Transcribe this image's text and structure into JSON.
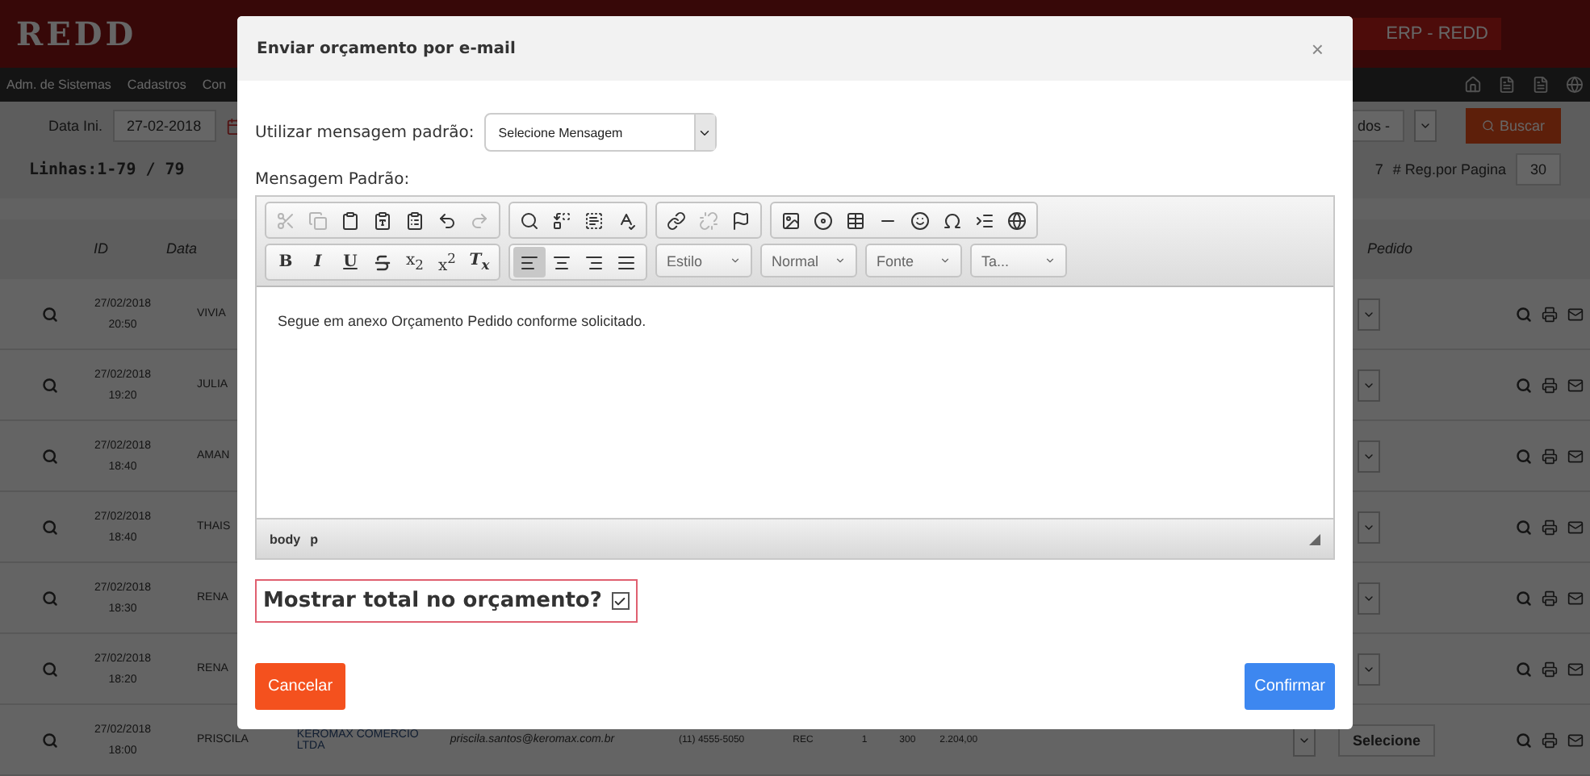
{
  "app": {
    "logo": "REDD",
    "system": "ERP - REDD",
    "nav": [
      "Adm. de Sistemas",
      "Cadastros",
      "Con"
    ],
    "filter": {
      "start_label": "Data Ini.",
      "start_value": "27-02-2018",
      "status_value": "dos -",
      "search_button": "Buscar"
    },
    "lines": "Linhas:1-79 / 79",
    "page_count": "7",
    "per_page_label": "# Reg.por Pagina",
    "per_page_value": "30",
    "columns": {
      "id": "ID",
      "date": "Data",
      "order": "Pedido"
    },
    "rows": [
      {
        "date": "27/02/2018",
        "time": "20:50",
        "name": "VIVIA"
      },
      {
        "date": "27/02/2018",
        "time": "19:20",
        "name": "JULIA"
      },
      {
        "date": "27/02/2018",
        "time": "18:40",
        "name": "AMAN"
      },
      {
        "date": "27/02/2018",
        "time": "18:40",
        "name": "THAIS"
      },
      {
        "date": "27/02/2018",
        "time": "18:30",
        "name": "RENA"
      },
      {
        "date": "27/02/2018",
        "time": "18:20",
        "name": "RENA"
      },
      {
        "date": "27/02/2018",
        "time": "18:00",
        "name": "PRISCILA",
        "details": {
          "company": "KEROMAX COMERCIO LTDA",
          "email": "priscila.santos@keromax.com.br",
          "phone": "(11) 4555-5050",
          "type": "REC",
          "qty": "1",
          "unit": "300",
          "total": "2.204,00",
          "status": "Selecione"
        }
      }
    ]
  },
  "dialog": {
    "title": "Enviar orçamento por e-mail",
    "close": "×",
    "template_label": "Utilizar mensagem padrão:",
    "template_value": "Selecione Mensagem",
    "message_label": "Mensagem Padrão:",
    "toolbar": [
      [
        {
          "kind": "cut",
          "disabled": true
        },
        {
          "kind": "copy",
          "disabled": true
        },
        {
          "kind": "paste",
          "disabled": false
        },
        {
          "kind": "paste-text",
          "disabled": false
        },
        {
          "kind": "paste-word",
          "disabled": false
        },
        {
          "kind": "undo",
          "disabled": false
        },
        {
          "kind": "redo",
          "disabled": true
        }
      ],
      [
        {
          "kind": "find",
          "disabled": false
        },
        {
          "kind": "replace",
          "disabled": false
        },
        {
          "kind": "select-all",
          "disabled": false
        },
        {
          "kind": "spell",
          "disabled": false
        }
      ],
      [
        {
          "kind": "link",
          "disabled": false
        },
        {
          "kind": "unlink",
          "disabled": true
        },
        {
          "kind": "anchor",
          "disabled": false
        }
      ],
      [
        {
          "kind": "image",
          "disabled": false
        },
        {
          "kind": "flash",
          "disabled": false
        },
        {
          "kind": "table",
          "disabled": false
        },
        {
          "kind": "rule",
          "disabled": false
        },
        {
          "kind": "smiley",
          "disabled": false
        },
        {
          "kind": "omega",
          "disabled": false
        },
        {
          "kind": "pagebreak",
          "disabled": false
        },
        {
          "kind": "iframe",
          "disabled": false
        }
      ]
    ],
    "format_buttons": [
      {
        "label": "B",
        "kind": "bold"
      },
      {
        "label": "I",
        "kind": "italic"
      },
      {
        "label": "U",
        "kind": "underline"
      },
      {
        "kind": "strike"
      },
      {
        "label": "x$_{2}$",
        "kind": "plain"
      },
      {
        "label": "x$^{2}$",
        "kind": "plain"
      },
      {
        "label": "T$_{x}$",
        "kind": "italic"
      }
    ],
    "align_buttons": [
      {
        "kind": "left",
        "selected": true
      },
      {
        "kind": "center",
        "selected": false
      },
      {
        "kind": "right",
        "selected": false
      },
      {
        "kind": "justify",
        "selected": false
      }
    ],
    "combos": [
      "Estilo",
      "Normal",
      "Fonte",
      "Ta..."
    ],
    "content": "Segue em anexo Orçamento Pedido conforme solicitado.",
    "path": [
      "body",
      "p"
    ],
    "show_total": {
      "label": "Mostrar total no orçamento?",
      "checked": true
    },
    "cancel": "Cancelar",
    "confirm": "Confirmar"
  }
}
